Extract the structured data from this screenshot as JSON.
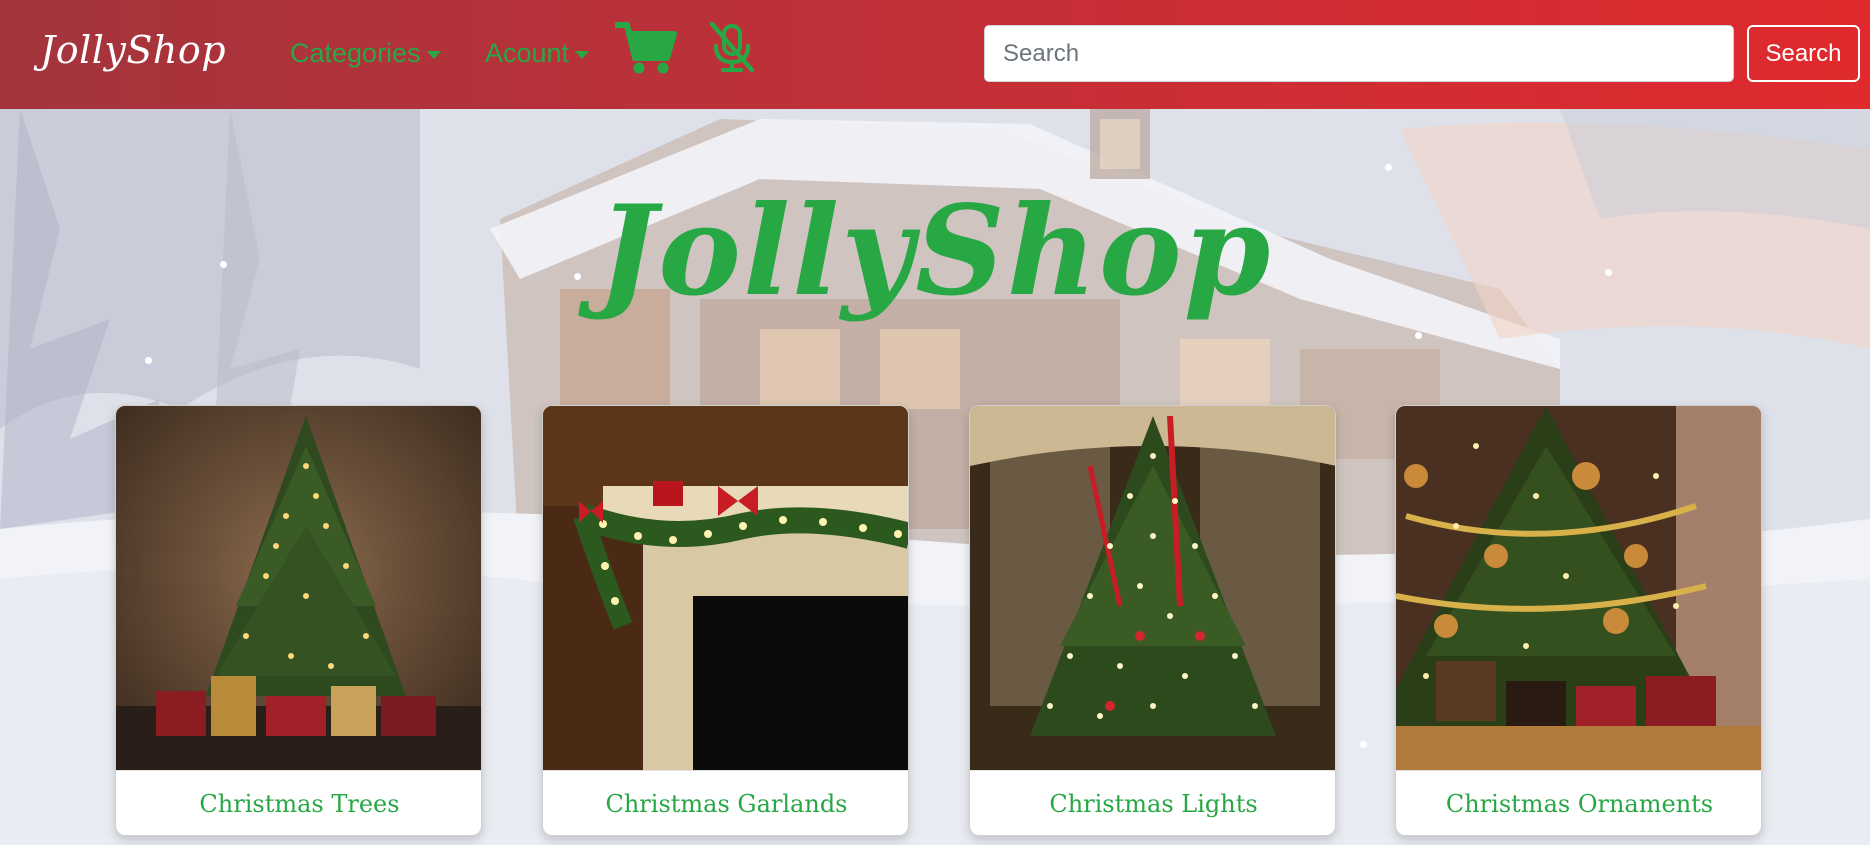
{
  "navbar": {
    "brand": "JollyShop",
    "categories_label": "Categories",
    "account_label": "Acount",
    "search": {
      "placeholder": "Search",
      "value": ""
    },
    "search_button_label": "Search",
    "icons": [
      "shopping-cart-icon",
      "microphone-off-icon"
    ]
  },
  "hero": {
    "title": "JollyShop"
  },
  "categories": [
    {
      "label": "Christmas Trees",
      "image": "christmas-tree-photo"
    },
    {
      "label": "Christmas Garlands",
      "image": "fireplace-garland-photo"
    },
    {
      "label": "Christmas Lights",
      "image": "lit-tree-photo"
    },
    {
      "label": "Christmas Ornaments",
      "image": "ornaments-tree-photo"
    }
  ],
  "colors": {
    "navbar_left": "#a3343c",
    "navbar_right": "#e02a2e",
    "accent_green": "#28a745",
    "white": "#ffffff"
  }
}
